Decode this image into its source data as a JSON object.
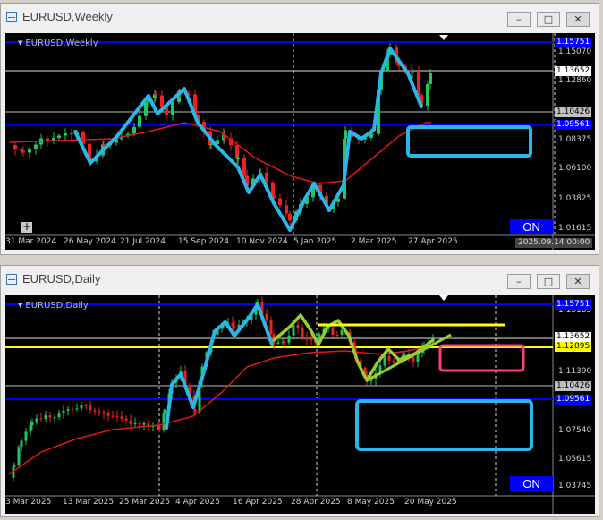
{
  "weekly": {
    "window_title": "EURUSD,Weekly",
    "symbol_label": "EURUSD,Weekly",
    "on_label": "ON",
    "date_tag": "2025.09.14 00:00",
    "price_labels": [
      "1.15070",
      "1.12860",
      "1.08375",
      "1.06100",
      "1.03825",
      "1.01615"
    ],
    "date_labels": [
      "31 Mar 2024",
      "26 May 2024",
      "21 Jul 2024",
      "15 Sep 2024",
      "10 Nov 2024",
      "5 Jan 2025",
      "2 Mar 2025",
      "27 Apr 2025"
    ],
    "tags": {
      "top_blue": "1.15751",
      "current": "1.13652",
      "level": "1.10426",
      "low_blue": "1.09561"
    }
  },
  "daily": {
    "window_title": "EURUSD,Daily",
    "symbol_label": "EURUSD,Daily",
    "on_label": "ON",
    "price_labels": [
      "1.15185",
      "1.11390",
      "1.07540",
      "1.05615",
      "1.03745"
    ],
    "date_labels": [
      "3 Mar 2025",
      "13 Mar 2025",
      "25 Mar 2025",
      "4 Apr 2025",
      "16 Apr 2025",
      "28 Apr 2025",
      "8 May 2025",
      "20 May 2025"
    ],
    "tags": {
      "top_blue": "1.15751",
      "current": "1.13652",
      "yellow": "1.12895",
      "level": "1.10426",
      "low_blue": "1.09561"
    }
  },
  "colors": {
    "up": "#22c55e",
    "down": "#ef2020",
    "ma": "#e01818",
    "drawing_cyan": "#29b6e8",
    "drawing_green": "#9acd32",
    "yellow": "#ffff00",
    "pink": "#ff3f7f",
    "blue_line": "#0000ff"
  }
}
